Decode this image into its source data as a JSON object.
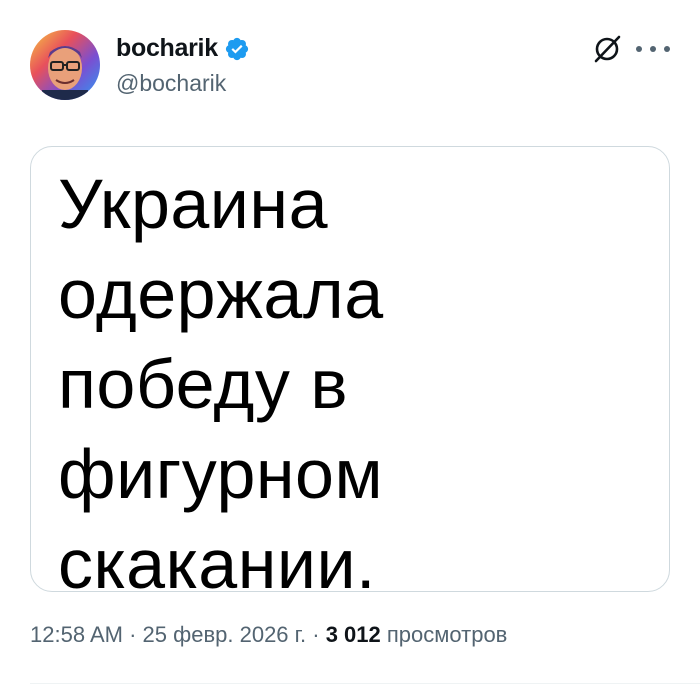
{
  "author": {
    "display_name": "bocharik",
    "handle": "@bocharik",
    "verified": true,
    "verified_color": "#1d9bf0"
  },
  "actions": {
    "grok_icon": "grok-icon",
    "more_icon": "more-options-icon"
  },
  "media": {
    "lines": [
      "Украина",
      "одержала",
      "победу в",
      "фигурном",
      "скакании."
    ]
  },
  "meta": {
    "time": "12:58 AM",
    "separator": "·",
    "date": "25 февр. 2026 г.",
    "views_count": "3 012",
    "views_label": "просмотров"
  },
  "colors": {
    "text_primary": "#0f1419",
    "text_secondary": "#536471",
    "border": "#cfd9de"
  }
}
